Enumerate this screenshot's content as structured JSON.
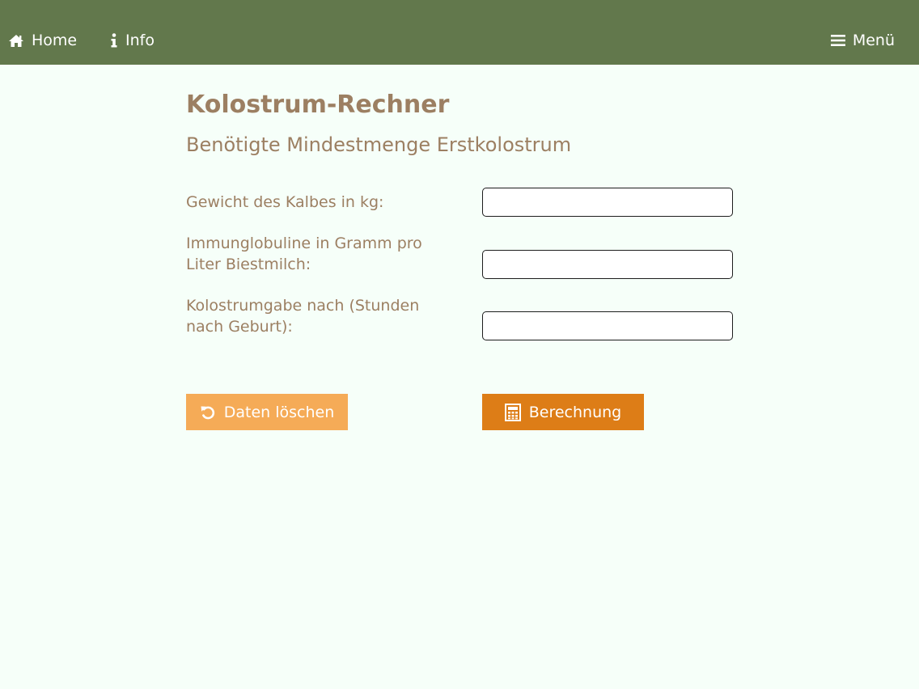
{
  "nav": {
    "home_label": "Home",
    "info_label": "Info",
    "menu_label": "Menü"
  },
  "page": {
    "title": "Kolostrum-Rechner",
    "subtitle": "Benötigte Mindestmenge Erstkolostrum"
  },
  "form": {
    "fields": [
      {
        "label": "Gewicht des Kalbes in kg:",
        "value": ""
      },
      {
        "label": "Immunglobuline in Gramm pro Liter Biestmilch:",
        "value": ""
      },
      {
        "label": "Kolostrumgabe nach (Stunden nach Geburt):",
        "value": ""
      }
    ],
    "reset_label": "Daten löschen",
    "calc_label": "Berechnung"
  },
  "colors": {
    "navbar": "#62784c",
    "text_brown": "#9c7f62",
    "reset_button": "#f5ab57",
    "calc_button": "#dd7d17",
    "background": "#f6fff9"
  },
  "icons": {
    "home": "home-icon",
    "info": "info-icon",
    "menu": "hamburger-menu-icon",
    "reset": "undo-icon",
    "calc": "calculator-icon"
  }
}
